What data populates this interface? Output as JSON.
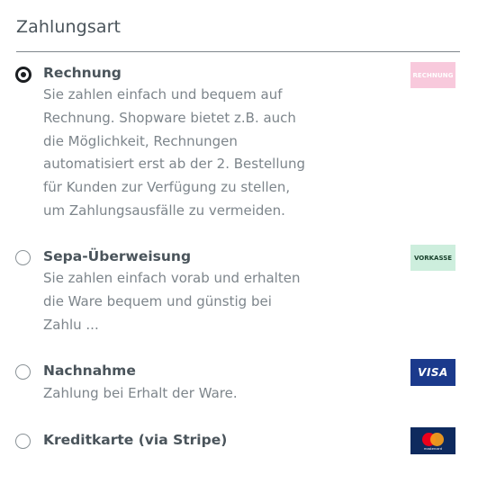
{
  "section": {
    "title": "Zahlungsart"
  },
  "options": [
    {
      "label": "Rechnung",
      "selected": true,
      "description_lines": [
        "Sie zahlen einfach und bequem auf",
        "Rechnung. Shopware bietet z.B. auch",
        "die Möglichkeit, Rechnungen",
        "automatisiert erst ab der 2. Bestellung",
        "für Kunden zur Verfügung zu stellen,",
        "um Zahlungsausfälle zu vermeiden."
      ],
      "logo_text": "RECHNUNG",
      "logo_color": "#f8c9dc"
    },
    {
      "label": "Sepa-Überweisung",
      "selected": false,
      "description_lines": [
        "Sie zahlen einfach vorab und erhalten",
        "die Ware bequem und günstig bei",
        "Zahlu ..."
      ],
      "logo_text": "VORKASSE",
      "logo_color": "#cdeedd"
    },
    {
      "label": "Nachnahme",
      "selected": false,
      "description_lines": [
        "Zahlung bei Erhalt der Ware."
      ],
      "logo_text": "VISA",
      "logo_color": "#1b3a8c"
    },
    {
      "label": "Kreditkarte (via Stripe)",
      "selected": false,
      "description_lines": [],
      "logo_text": "mastercard",
      "logo_color": "#0e2a5e"
    }
  ]
}
